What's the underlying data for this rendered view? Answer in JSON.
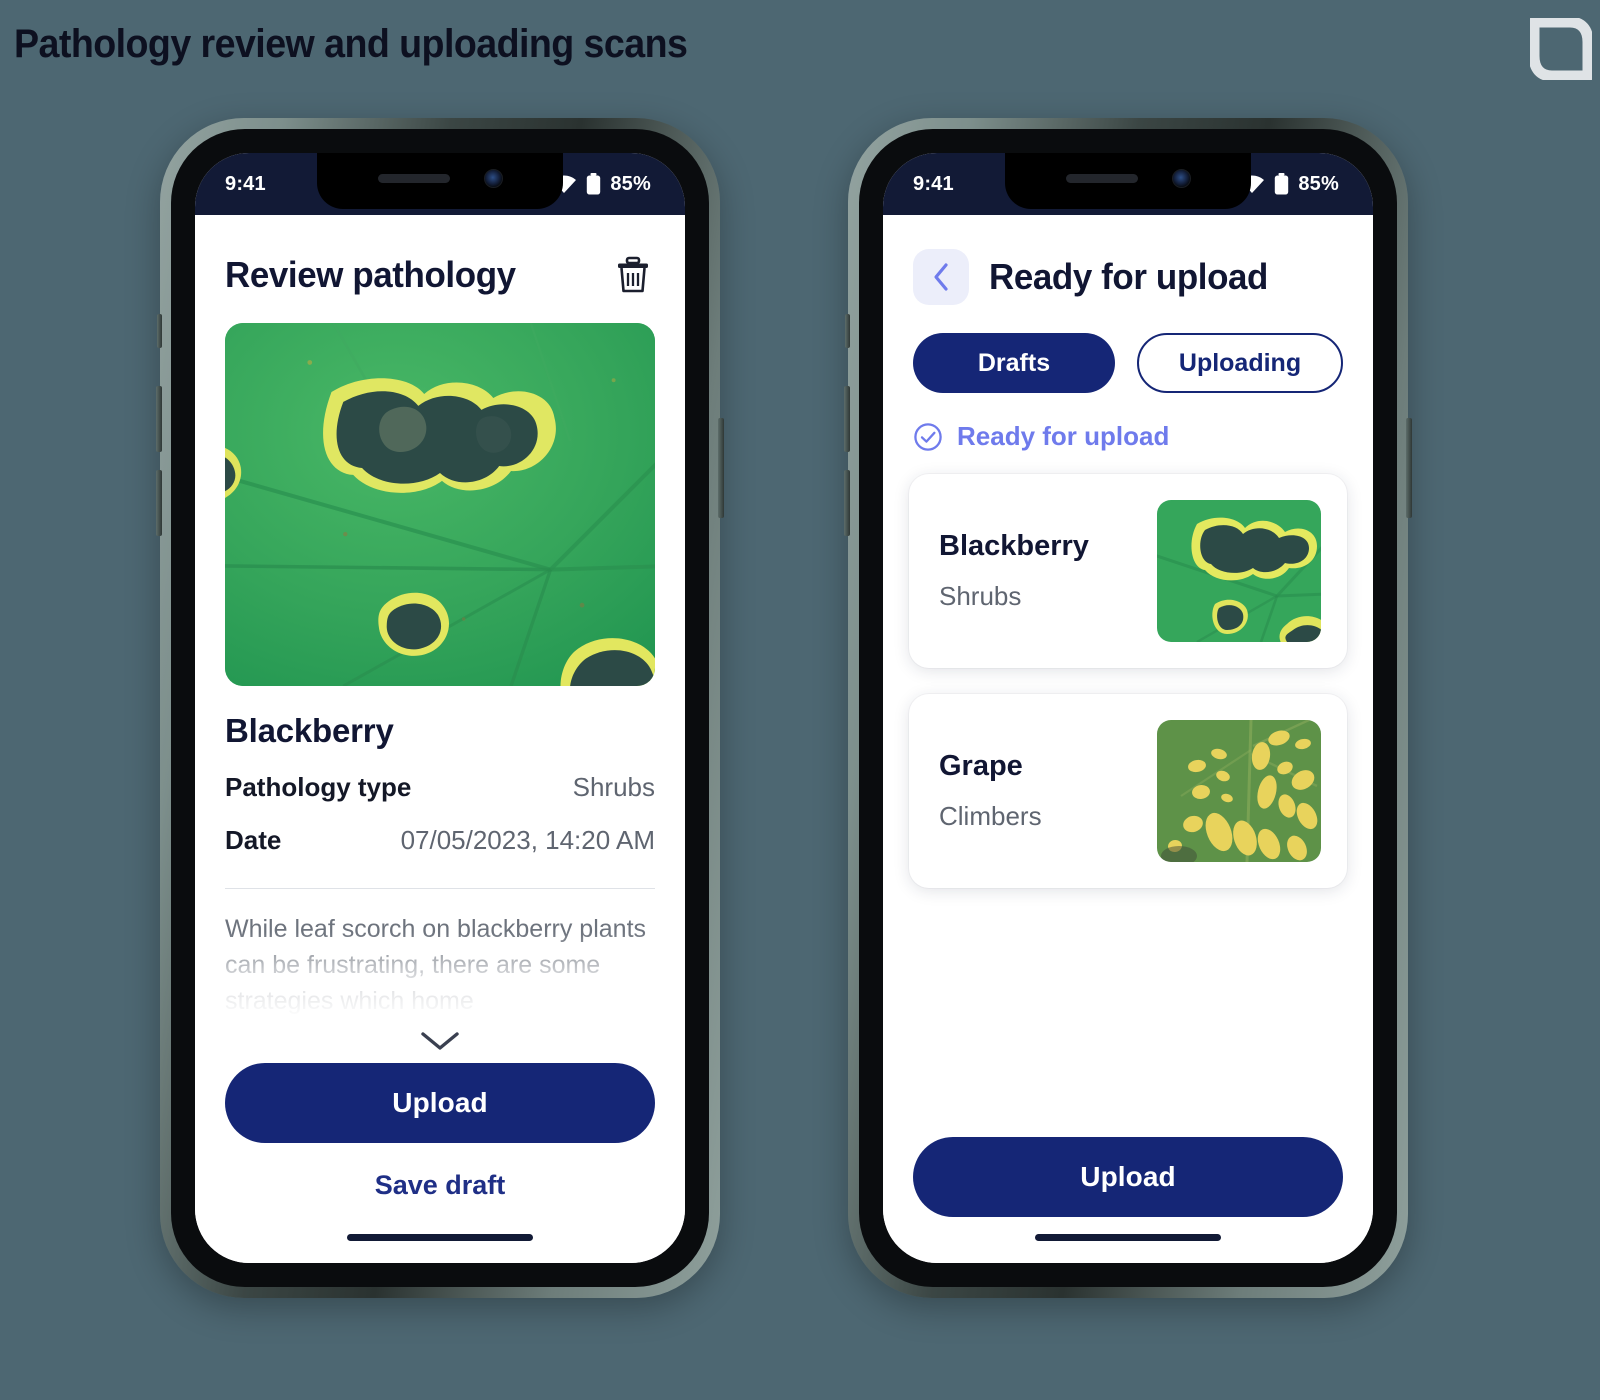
{
  "page": {
    "title": "Pathology review and uploading scans",
    "background_color": "#4d6772",
    "logo_name": "leaf-brand-logo"
  },
  "colors": {
    "navy": "#152676",
    "periwinkle": "#6f7bec",
    "text_dark": "#111633",
    "text_muted": "#5f6570",
    "status_bar": "#121a36"
  },
  "status_bar": {
    "time": "9:41",
    "battery": "85%",
    "wifi_icon": "wifi-icon",
    "battery_icon": "battery-icon"
  },
  "screen_review": {
    "header": {
      "title": "Review pathology",
      "delete_icon": "trash-icon"
    },
    "photo_alt": "leaf-with-dark-lesions-photo",
    "plant_name": "Blackberry",
    "rows": [
      {
        "key": "Pathology type",
        "value": "Shrubs"
      },
      {
        "key": "Date",
        "value": "07/05/2023, 14:20 AM"
      }
    ],
    "description": "While leaf scorch on blackberry plants can be frustrating, there are some strategies which home",
    "expand_icon": "chevron-down-icon",
    "primary_button": "Upload",
    "secondary_button": "Save draft"
  },
  "screen_upload": {
    "header": {
      "back_icon": "chevron-left-icon",
      "title": "Ready for upload"
    },
    "tabs": [
      {
        "label": "Drafts",
        "active": true
      },
      {
        "label": "Uploading",
        "active": false
      }
    ],
    "status": {
      "icon": "check-circle-icon",
      "label": "Ready for upload"
    },
    "cards": [
      {
        "title": "Blackberry",
        "subtitle": "Shrubs",
        "thumb_alt": "blackberry-leaf-thumbnail"
      },
      {
        "title": "Grape",
        "subtitle": "Climbers",
        "thumb_alt": "grape-leaf-thumbnail"
      }
    ],
    "primary_button": "Upload"
  }
}
